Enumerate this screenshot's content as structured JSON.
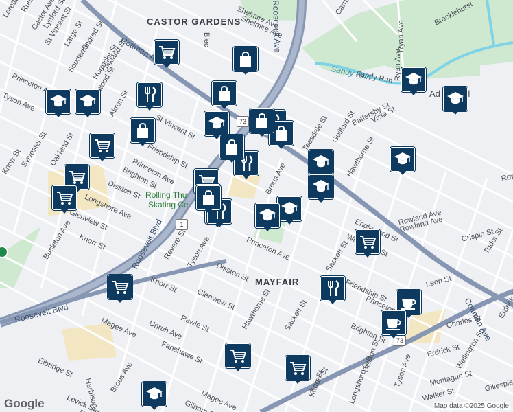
{
  "map": {
    "area_labels": [
      "CASTOR GARDENS",
      "MAYFAIR"
    ],
    "water_label": "Sandy Run",
    "park_label": "Rolling Thunder Skating Center",
    "park_label_line1": "Rolling Thu",
    "park_label_line2": "Skating Ce",
    "highway_labels": [
      "Roosevelt Blvd",
      "Cottman Ave",
      "Cottman Ave",
      "Roosevelt Blvd",
      "Roosevelt Ave"
    ],
    "route_shields": [
      "1",
      "73",
      "73"
    ],
    "school_label": "Ad   School",
    "street_labels": [
      "Loretto Ave",
      "Rutland St",
      "Castor Ave",
      "Lynford St",
      "St Vincent St",
      "Large St",
      "Kindred St",
      "Souder St",
      "Horrocks St",
      "Oakland St",
      "Princeton Ave",
      "Eastwood St",
      "Akron St",
      "Tyson Ave",
      "St Vincent St",
      "Friendship St",
      "Princeton Ave",
      "Brighton St",
      "Sylvester St",
      "Oakland St",
      "Knorr St",
      "Disston St",
      "Longshore Ave",
      "Glenview St",
      "Knorr St",
      "Busleton Ave",
      "Shelmire Ave",
      "Blec",
      "Brous Ave",
      "Disston St",
      "Glenview St",
      "Revere St",
      "Knorr St",
      "Hawthorne St",
      "Sackett St",
      "Rawle St",
      "Fanshawe St",
      "Magee Ave",
      "Harbison Ave",
      "Elbridge St",
      "Levick St",
      "Robb",
      "Gilham St",
      "Brous Ave",
      "Unruh Ave",
      "Magee Ave",
      "Princeton Ave",
      "Teesdale St",
      "Guilford St",
      "Battersby St",
      "Vista St",
      "Hawthorne St",
      "Englewood St",
      "Wellington St",
      "Sackett St",
      "Friendship St",
      "Princeton Ave",
      "Brighton St",
      "Tyson Ave",
      "Longshore Ave",
      "Disston St",
      "Knorr St",
      "Rowland Ave",
      "Crispin St",
      "Tudor St",
      "Erdrick St",
      "Charles St",
      "Wellington St",
      "Montague St",
      "Walker St",
      "Gillespie",
      "Erdrick St",
      "Ryan Ave",
      "Sandy Run",
      "Brocklehurst",
      "Carnwath St",
      "Ryan Ave",
      "Tyson Ave",
      "Rowl",
      "Leon St",
      "Rowland Ave",
      "Knorr St",
      "Shelmire Ave"
    ],
    "attribution": "Map data ©2025 Google",
    "logo": "Google"
  },
  "pois": [
    {
      "type": "school",
      "icon": "graduation-cap-icon"
    },
    {
      "type": "school",
      "icon": "graduation-cap-icon"
    },
    {
      "type": "school",
      "icon": "graduation-cap-icon"
    },
    {
      "type": "school",
      "icon": "graduation-cap-icon"
    },
    {
      "type": "school",
      "icon": "graduation-cap-icon"
    },
    {
      "type": "school",
      "icon": "graduation-cap-icon"
    },
    {
      "type": "school",
      "icon": "graduation-cap-icon"
    },
    {
      "type": "school",
      "icon": "graduation-cap-icon"
    },
    {
      "type": "school",
      "icon": "graduation-cap-icon"
    },
    {
      "type": "school",
      "icon": "graduation-cap-icon"
    },
    {
      "type": "school",
      "icon": "graduation-cap-icon"
    },
    {
      "type": "grocery",
      "icon": "shopping-cart-icon"
    },
    {
      "type": "grocery",
      "icon": "shopping-cart-icon"
    },
    {
      "type": "grocery",
      "icon": "shopping-cart-icon"
    },
    {
      "type": "grocery",
      "icon": "shopping-cart-icon"
    },
    {
      "type": "grocery",
      "icon": "shopping-cart-icon"
    },
    {
      "type": "grocery",
      "icon": "shopping-cart-icon"
    },
    {
      "type": "grocery",
      "icon": "shopping-cart-icon"
    },
    {
      "type": "grocery",
      "icon": "shopping-cart-icon"
    },
    {
      "type": "grocery",
      "icon": "shopping-cart-icon"
    },
    {
      "type": "grocery",
      "icon": "shopping-cart-icon"
    },
    {
      "type": "restaurant",
      "icon": "fork-knife-icon"
    },
    {
      "type": "restaurant",
      "icon": "fork-knife-icon"
    },
    {
      "type": "restaurant",
      "icon": "fork-knife-icon"
    },
    {
      "type": "restaurant",
      "icon": "fork-knife-icon"
    },
    {
      "type": "restaurant",
      "icon": "fork-knife-icon"
    },
    {
      "type": "restaurant",
      "icon": "fork-knife-icon"
    },
    {
      "type": "shopping",
      "icon": "shopping-bag-icon"
    },
    {
      "type": "shopping",
      "icon": "shopping-bag-icon"
    },
    {
      "type": "shopping",
      "icon": "shopping-bag-icon"
    },
    {
      "type": "shopping",
      "icon": "shopping-bag-icon"
    },
    {
      "type": "shopping",
      "icon": "shopping-bag-icon"
    },
    {
      "type": "shopping",
      "icon": "shopping-bag-icon"
    },
    {
      "type": "shopping",
      "icon": "shopping-bag-icon"
    },
    {
      "type": "cafe",
      "icon": "coffee-cup-icon"
    },
    {
      "type": "cafe",
      "icon": "coffee-cup-icon"
    }
  ],
  "colors": {
    "pin": "#0e3a5f",
    "road": "#ffffff",
    "highway": "#8797b3",
    "park": "#c8e6c9",
    "water": "#7fd3e6",
    "land": "#eef0f3"
  }
}
